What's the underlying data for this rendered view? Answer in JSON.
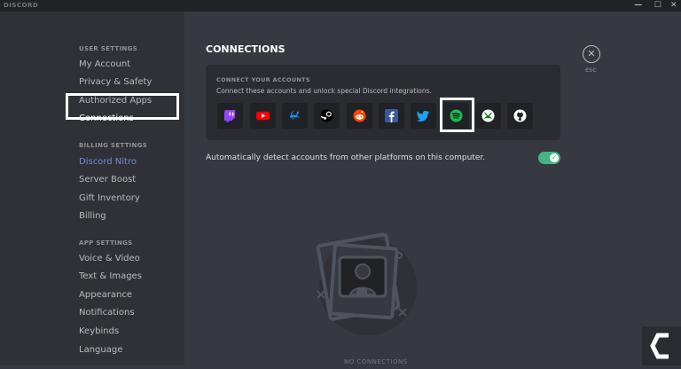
{
  "titlebar": {
    "app_name": "DISCORD",
    "minimize": "—",
    "maximize": "☐",
    "close": "✕"
  },
  "sidebar": {
    "user_settings_header": "USER SETTINGS",
    "user_items": [
      {
        "label": "My Account"
      },
      {
        "label": "Privacy & Safety"
      },
      {
        "label": "Authorized Apps"
      },
      {
        "label": "Connections",
        "selected": true
      }
    ],
    "billing_settings_header": "BILLING SETTINGS",
    "billing_items": [
      {
        "label": "Discord Nitro"
      },
      {
        "label": "Server Boost"
      },
      {
        "label": "Gift Inventory"
      },
      {
        "label": "Billing"
      }
    ],
    "app_settings_header": "APP SETTINGS",
    "app_items": [
      {
        "label": "Voice & Video"
      },
      {
        "label": "Text & Images"
      },
      {
        "label": "Appearance"
      },
      {
        "label": "Notifications"
      },
      {
        "label": "Keybinds"
      },
      {
        "label": "Language"
      }
    ]
  },
  "main": {
    "title": "CONNECTIONS",
    "close_icon": "✕",
    "close_label": "ESC",
    "connect": {
      "header": "CONNECT YOUR ACCOUNTS",
      "description": "Connect these accounts and unlock special Discord integrations.",
      "services": [
        {
          "name": "twitch",
          "color": "#9146ff"
        },
        {
          "name": "youtube",
          "color": "#ff0000"
        },
        {
          "name": "battlenet",
          "color": "#148eff"
        },
        {
          "name": "steam",
          "color": "#ffffff"
        },
        {
          "name": "reddit",
          "color": "#ff4500"
        },
        {
          "name": "facebook",
          "color": "#3b5998"
        },
        {
          "name": "twitter",
          "color": "#1da1f2"
        },
        {
          "name": "spotify",
          "color": "#1db954"
        },
        {
          "name": "xbox",
          "color": "#107c10"
        },
        {
          "name": "github",
          "color": "#ffffff"
        }
      ]
    },
    "auto_detect_label": "Automatically detect accounts from other platforms on this computer.",
    "auto_detect_enabled": true,
    "toggle_check": "✓",
    "empty_text": "NO CONNECTIONS"
  }
}
